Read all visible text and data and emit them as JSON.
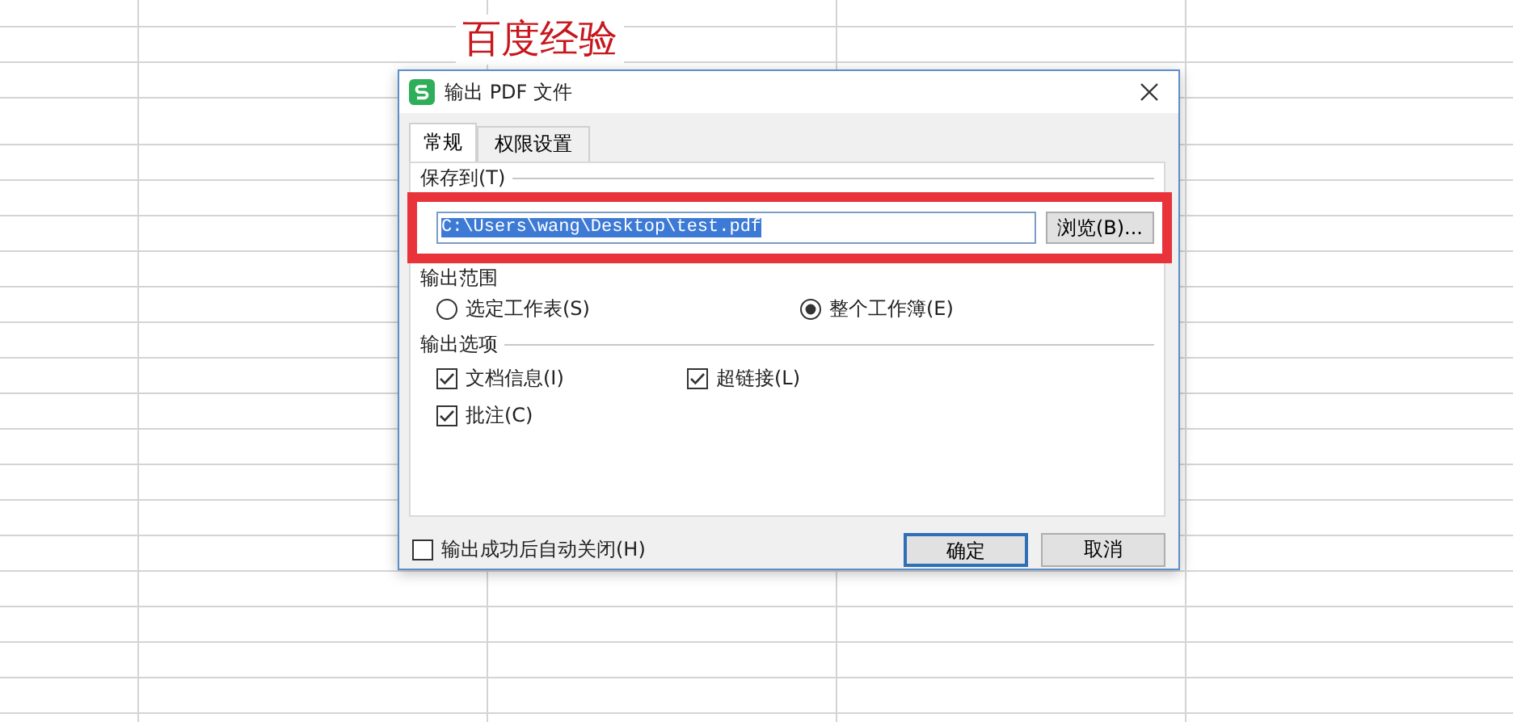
{
  "background_heading": "百度经验",
  "window": {
    "title": "输出 PDF 文件"
  },
  "tabs": [
    {
      "label": "常规",
      "selected": true
    },
    {
      "label": "权限设置",
      "selected": false
    }
  ],
  "save_to": {
    "label": "保存到(T)",
    "value": "C:\\Users\\wang\\Desktop\\test.pdf",
    "value_selected": true,
    "browse_button": "浏览(B)..."
  },
  "output_range": {
    "label": "输出范围",
    "options": [
      {
        "label": "选定工作表(S)",
        "selected": false
      },
      {
        "label": "整个工作簿(E)",
        "selected": true
      }
    ]
  },
  "output_options": {
    "label": "输出选项",
    "items": [
      {
        "label": "文档信息(I)",
        "checked": true
      },
      {
        "label": "超链接(L)",
        "checked": true
      },
      {
        "label": "批注(C)",
        "checked": true
      }
    ]
  },
  "auto_close": {
    "label": "输出成功后自动关闭(H)",
    "checked": false
  },
  "buttons": [
    {
      "label": "确定",
      "default": true
    },
    {
      "label": "取消",
      "default": false
    }
  ],
  "highlight": true
}
